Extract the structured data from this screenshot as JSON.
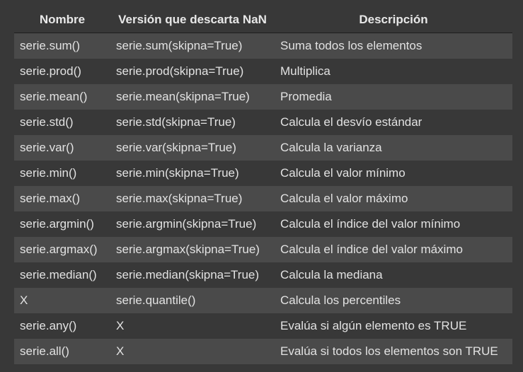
{
  "table": {
    "headers": [
      "Nombre",
      "Versión que descarta NaN",
      "Descripción"
    ],
    "rows": [
      [
        "serie.sum()",
        "serie.sum(skipna=True)",
        "Suma todos los elementos"
      ],
      [
        "serie.prod()",
        "serie.prod(skipna=True)",
        "Multiplica"
      ],
      [
        "serie.mean()",
        "serie.mean(skipna=True)",
        "Promedia"
      ],
      [
        "serie.std()",
        "serie.std(skipna=True)",
        "Calcula el desvío estándar"
      ],
      [
        "serie.var()",
        "serie.var(skipna=True)",
        "Calcula la varianza"
      ],
      [
        "serie.min()",
        "serie.min(skipna=True)",
        "Calcula el valor mínimo"
      ],
      [
        "serie.max()",
        "serie.max(skipna=True)",
        "Calcula el valor máximo"
      ],
      [
        "serie.argmin()",
        "serie.argmin(skipna=True)",
        "Calcula el índice del valor mínimo"
      ],
      [
        "serie.argmax()",
        "serie.argmax(skipna=True)",
        "Calcula el índice del valor máximo"
      ],
      [
        "serie.median()",
        "serie.median(skipna=True)",
        "Calcula la mediana"
      ],
      [
        "X",
        "serie.quantile()",
        "Calcula los percentiles"
      ],
      [
        "serie.any()",
        "X",
        "Evalúa si algún elemento es TRUE"
      ],
      [
        "serie.all()",
        "X",
        "Evalúa si todos los elementos son TRUE"
      ]
    ]
  }
}
